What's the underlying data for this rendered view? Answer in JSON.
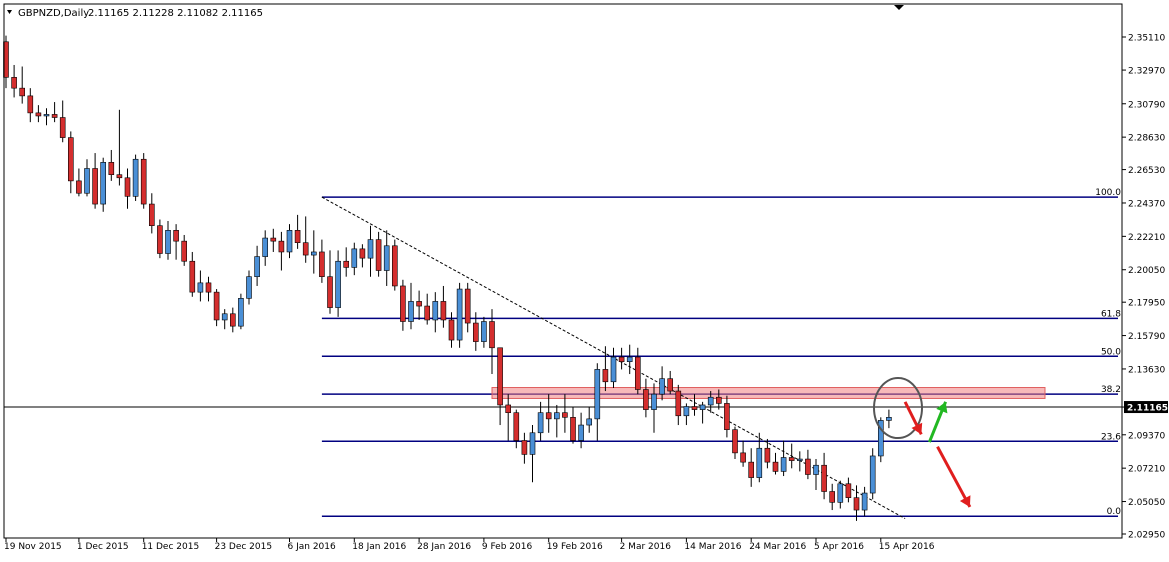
{
  "header": {
    "symbol": "GBPNZD,Daily",
    "ohlc": "2.11165 2.11228 2.11082 2.11165"
  },
  "colors": {
    "bull": "#4a8fd6",
    "bear": "#d42e2e",
    "fib": "#000080",
    "zone": "#f08080",
    "up_arrow": "#22b822",
    "down_arrow": "#e01e1e",
    "circle": "#555555"
  },
  "chart_data": {
    "type": "candlestick",
    "symbol": "GBPNZD",
    "timeframe": "Daily",
    "price_range": [
      2.0296,
      2.3611
    ],
    "current_price": 2.11165,
    "y_ticks": [
      "2.35110",
      "2.32970",
      "2.30790",
      "2.28630",
      "2.26530",
      "2.24370",
      "2.22210",
      "2.20050",
      "2.17950",
      "2.15790",
      "2.13630",
      "2.11165",
      "2.09370",
      "2.07210",
      "2.05050",
      "2.02950"
    ],
    "x_ticks": [
      {
        "label": "19 Nov 2015",
        "index": 0
      },
      {
        "label": "1 Dec 2015",
        "index": 9
      },
      {
        "label": "11 Dec 2015",
        "index": 17
      },
      {
        "label": "23 Dec 2015",
        "index": 26
      },
      {
        "label": "6 Jan 2016",
        "index": 35
      },
      {
        "label": "18 Jan 2016",
        "index": 43
      },
      {
        "label": "28 Jan 2016",
        "index": 51
      },
      {
        "label": "9 Feb 2016",
        "index": 59
      },
      {
        "label": "19 Feb 2016",
        "index": 67
      },
      {
        "label": "2 Mar 2016",
        "index": 76
      },
      {
        "label": "14 Mar 2016",
        "index": 84
      },
      {
        "label": "24 Mar 2016",
        "index": 92
      },
      {
        "label": "5 Apr 2016",
        "index": 100
      },
      {
        "label": "15 Apr 2016",
        "index": 108
      }
    ],
    "candles": [
      [
        2.348,
        2.352,
        2.318,
        2.325
      ],
      [
        2.325,
        2.333,
        2.312,
        2.318
      ],
      [
        2.318,
        2.332,
        2.308,
        2.313
      ],
      [
        2.313,
        2.318,
        2.296,
        2.302
      ],
      [
        2.302,
        2.307,
        2.296,
        2.3
      ],
      [
        2.3,
        2.305,
        2.294,
        2.301
      ],
      [
        2.301,
        2.309,
        2.296,
        2.299
      ],
      [
        2.299,
        2.31,
        2.283,
        2.286
      ],
      [
        2.286,
        2.29,
        2.25,
        2.258
      ],
      [
        2.258,
        2.266,
        2.248,
        2.25
      ],
      [
        2.25,
        2.272,
        2.248,
        2.266
      ],
      [
        2.266,
        2.276,
        2.24,
        2.243
      ],
      [
        2.243,
        2.273,
        2.238,
        2.27
      ],
      [
        2.27,
        2.278,
        2.258,
        2.262
      ],
      [
        2.262,
        2.304,
        2.255,
        2.26
      ],
      [
        2.26,
        2.266,
        2.24,
        2.248
      ],
      [
        2.248,
        2.275,
        2.245,
        2.272
      ],
      [
        2.272,
        2.276,
        2.24,
        2.243
      ],
      [
        2.243,
        2.25,
        2.224,
        2.229
      ],
      [
        2.229,
        2.233,
        2.208,
        2.211
      ],
      [
        2.211,
        2.232,
        2.207,
        2.226
      ],
      [
        2.226,
        2.23,
        2.207,
        2.219
      ],
      [
        2.219,
        2.223,
        2.203,
        2.206
      ],
      [
        2.206,
        2.212,
        2.183,
        2.186
      ],
      [
        2.186,
        2.2,
        2.18,
        2.192
      ],
      [
        2.192,
        2.196,
        2.18,
        2.186
      ],
      [
        2.186,
        2.188,
        2.164,
        2.168
      ],
      [
        2.168,
        2.175,
        2.162,
        2.172
      ],
      [
        2.172,
        2.176,
        2.16,
        2.164
      ],
      [
        2.164,
        2.185,
        2.162,
        2.182
      ],
      [
        2.182,
        2.2,
        2.178,
        2.196
      ],
      [
        2.196,
        2.216,
        2.19,
        2.209
      ],
      [
        2.209,
        2.226,
        2.203,
        2.221
      ],
      [
        2.221,
        2.227,
        2.212,
        2.219
      ],
      [
        2.219,
        2.225,
        2.2,
        2.212
      ],
      [
        2.212,
        2.23,
        2.208,
        2.226
      ],
      [
        2.226,
        2.236,
        2.214,
        2.218
      ],
      [
        2.218,
        2.235,
        2.205,
        2.21
      ],
      [
        2.21,
        2.226,
        2.198,
        2.212
      ],
      [
        2.212,
        2.22,
        2.192,
        2.196
      ],
      [
        2.196,
        2.213,
        2.172,
        2.176
      ],
      [
        2.176,
        2.213,
        2.17,
        2.206
      ],
      [
        2.206,
        2.215,
        2.196,
        2.202
      ],
      [
        2.202,
        2.218,
        2.197,
        2.214
      ],
      [
        2.214,
        2.217,
        2.202,
        2.208
      ],
      [
        2.208,
        2.229,
        2.196,
        2.22
      ],
      [
        2.22,
        2.225,
        2.196,
        2.2
      ],
      [
        2.2,
        2.226,
        2.19,
        2.216
      ],
      [
        2.216,
        2.22,
        2.187,
        2.19
      ],
      [
        2.19,
        2.194,
        2.161,
        2.167
      ],
      [
        2.167,
        2.192,
        2.162,
        2.18
      ],
      [
        2.18,
        2.187,
        2.168,
        2.177
      ],
      [
        2.177,
        2.185,
        2.165,
        2.168
      ],
      [
        2.168,
        2.186,
        2.16,
        2.18
      ],
      [
        2.18,
        2.19,
        2.163,
        2.168
      ],
      [
        2.168,
        2.173,
        2.15,
        2.155
      ],
      [
        2.155,
        2.192,
        2.15,
        2.188
      ],
      [
        2.188,
        2.192,
        2.16,
        2.166
      ],
      [
        2.166,
        2.173,
        2.148,
        2.154
      ],
      [
        2.154,
        2.17,
        2.15,
        2.167
      ],
      [
        2.167,
        2.175,
        2.133,
        2.15
      ],
      [
        2.15,
        2.15,
        2.1,
        2.113
      ],
      [
        2.113,
        2.12,
        2.09,
        2.108
      ],
      [
        2.108,
        2.11,
        2.085,
        2.09
      ],
      [
        2.09,
        2.095,
        2.075,
        2.081
      ],
      [
        2.081,
        2.1,
        2.063,
        2.095
      ],
      [
        2.095,
        2.115,
        2.09,
        2.108
      ],
      [
        2.108,
        2.12,
        2.095,
        2.104
      ],
      [
        2.104,
        2.113,
        2.092,
        2.108
      ],
      [
        2.108,
        2.12,
        2.095,
        2.105
      ],
      [
        2.105,
        2.112,
        2.088,
        2.09
      ],
      [
        2.09,
        2.108,
        2.085,
        2.1
      ],
      [
        2.1,
        2.112,
        2.095,
        2.104
      ],
      [
        2.104,
        2.14,
        2.09,
        2.136
      ],
      [
        2.136,
        2.151,
        2.122,
        2.128
      ],
      [
        2.128,
        2.15,
        2.124,
        2.144
      ],
      [
        2.144,
        2.15,
        2.136,
        2.141
      ],
      [
        2.141,
        2.152,
        2.133,
        2.144
      ],
      [
        2.144,
        2.15,
        2.12,
        2.123
      ],
      [
        2.123,
        2.13,
        2.105,
        2.11
      ],
      [
        2.11,
        2.127,
        2.095,
        2.12
      ],
      [
        2.12,
        2.138,
        2.116,
        2.13
      ],
      [
        2.13,
        2.135,
        2.12,
        2.122
      ],
      [
        2.122,
        2.126,
        2.1,
        2.106
      ],
      [
        2.106,
        2.114,
        2.1,
        2.112
      ],
      [
        2.112,
        2.12,
        2.106,
        2.11
      ],
      [
        2.11,
        2.115,
        2.101,
        2.113
      ],
      [
        2.113,
        2.122,
        2.108,
        2.118
      ],
      [
        2.118,
        2.123,
        2.11,
        2.114
      ],
      [
        2.114,
        2.119,
        2.092,
        2.097
      ],
      [
        2.097,
        2.099,
        2.078,
        2.082
      ],
      [
        2.082,
        2.09,
        2.073,
        2.076
      ],
      [
        2.076,
        2.085,
        2.06,
        2.066
      ],
      [
        2.066,
        2.095,
        2.063,
        2.085
      ],
      [
        2.085,
        2.091,
        2.072,
        2.076
      ],
      [
        2.076,
        2.082,
        2.068,
        2.07
      ],
      [
        2.07,
        2.09,
        2.067,
        2.079
      ],
      [
        2.079,
        2.088,
        2.072,
        2.077
      ],
      [
        2.077,
        2.083,
        2.07,
        2.078
      ],
      [
        2.078,
        2.084,
        2.065,
        2.068
      ],
      [
        2.068,
        2.078,
        2.058,
        2.074
      ],
      [
        2.074,
        2.082,
        2.052,
        2.057
      ],
      [
        2.057,
        2.062,
        2.045,
        2.05
      ],
      [
        2.05,
        2.064,
        2.046,
        2.062
      ],
      [
        2.062,
        2.066,
        2.05,
        2.053
      ],
      [
        2.053,
        2.061,
        2.038,
        2.045
      ],
      [
        2.045,
        2.06,
        2.041,
        2.056
      ],
      [
        2.056,
        2.085,
        2.052,
        2.08
      ],
      [
        2.08,
        2.105,
        2.076,
        2.103
      ],
      [
        2.103,
        2.11,
        2.098,
        2.105
      ]
    ],
    "fib_levels": [
      {
        "label": "100.0",
        "price": 2.2475
      },
      {
        "label": "61.8",
        "price": 2.169
      },
      {
        "label": "50.0",
        "price": 2.1445
      },
      {
        "label": "38.2",
        "price": 2.12
      },
      {
        "label": "23.6",
        "price": 2.0895
      },
      {
        "label": "0.0",
        "price": 2.041
      }
    ],
    "fib_start_index": 39,
    "resistance_zone": [
      2.1185,
      2.123
    ],
    "trendline": {
      "from": [
        39,
        2.2475
      ],
      "to": [
        111,
        2.0395
      ]
    },
    "annotations": [
      {
        "type": "ellipse",
        "index": 110,
        "price": 2.111
      },
      {
        "type": "arrow-down",
        "color_key": "down_arrow",
        "from": [
          111,
          2.115
        ],
        "to": [
          113,
          2.094
        ]
      },
      {
        "type": "arrow-up",
        "color_key": "up_arrow",
        "from": [
          114,
          2.089
        ],
        "to": [
          116,
          2.115
        ]
      },
      {
        "type": "arrow-down",
        "color_key": "down_arrow",
        "from": [
          115,
          2.086
        ],
        "to": [
          119,
          2.047
        ]
      }
    ]
  }
}
